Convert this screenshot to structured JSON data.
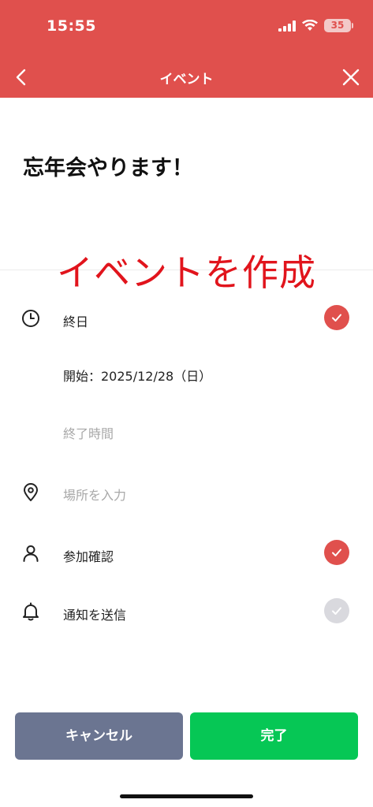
{
  "status_bar": {
    "time": "15:55",
    "battery": "35",
    "icons": [
      "signal-icon",
      "wifi-icon",
      "battery-icon"
    ]
  },
  "header": {
    "title": "イベント",
    "back_icon": "chevron-left-icon",
    "close_icon": "close-icon",
    "color": "#e0504d"
  },
  "event": {
    "title": "忘年会やります！"
  },
  "overlay_caption": "イベントを作成",
  "form": {
    "all_day": {
      "label": "終日",
      "checked": true,
      "icon": "clock-icon"
    },
    "start": {
      "label": "開始：2025/12/28（日）"
    },
    "end": {
      "placeholder": "終了時間"
    },
    "location": {
      "placeholder": "場所を入力",
      "icon": "location-pin-icon"
    },
    "rsvp": {
      "label": "参加確認",
      "checked": true,
      "icon": "person-icon"
    },
    "notify": {
      "label": "通知を送信",
      "checked": false,
      "icon": "bell-icon"
    }
  },
  "buttons": {
    "cancel": "キャンセル",
    "done": "完了"
  },
  "colors": {
    "accent": "#e0504d",
    "done": "#06c755",
    "cancel": "#6b7591",
    "caption": "#e1141c"
  }
}
